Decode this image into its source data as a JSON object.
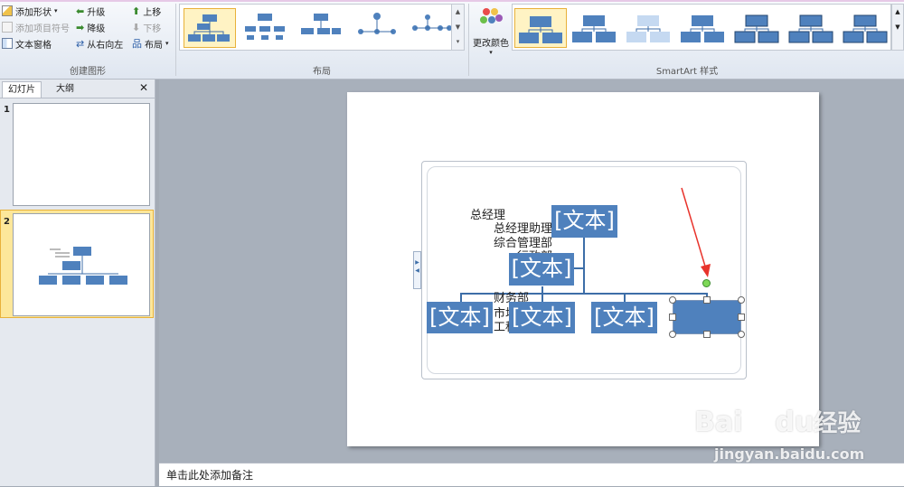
{
  "ribbon": {
    "create_graphic": {
      "add_shape": "添加形状",
      "add_bullet": "添加项目符号",
      "text_pane": "文本窗格",
      "promote": "升级",
      "demote": "降级",
      "right_to_left": "从右向左",
      "move_up": "上移",
      "move_down": "下移",
      "layout": "布局",
      "group_label": "创建图形"
    },
    "layouts": {
      "group_label": "布局",
      "count": 5,
      "selected_index": 0
    },
    "change_colors": "更改颜色",
    "styles": {
      "group_label": "SmartArt 样式",
      "count": 7,
      "selected_index": 0
    }
  },
  "left_pane": {
    "tab_slides": "幻灯片",
    "tab_outline": "大纲",
    "close": "✕",
    "slides": [
      {
        "number": "1"
      },
      {
        "number": "2"
      }
    ],
    "selected_slide": "2"
  },
  "smartart": {
    "placeholder": "[文本]",
    "pane_lines": [
      "总经理",
      "总经理助理",
      "综合管理部",
      "行政部",
      "财务部",
      "市场部",
      "工程部"
    ],
    "text_pane_arrow_icon": "triangle-right-icon"
  },
  "notes": {
    "placeholder": "单击此处添加备注"
  },
  "watermark": {
    "brand": "Bai",
    "brand_tail": "du",
    "brand_cn": "经验",
    "url": "jingyan.baidu.com"
  },
  "colors": {
    "accent": "#4f81bd",
    "selection": "#e8b13a",
    "arrow": "#e8332b"
  }
}
